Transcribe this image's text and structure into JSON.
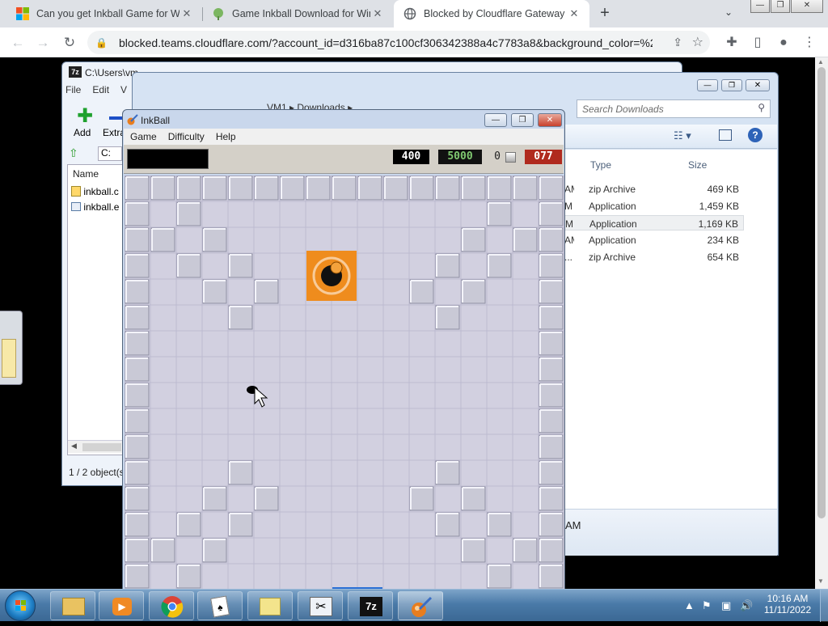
{
  "browser": {
    "tabs": [
      {
        "title": "Can you get Inkball Game for Wi",
        "favicon": "microsoft-icon",
        "active": false
      },
      {
        "title": "Game Inkball Download for Wind",
        "favicon": "brain-icon",
        "active": false
      },
      {
        "title": "Blocked by Cloudflare Gateway",
        "favicon": "globe-icon",
        "active": true
      }
    ],
    "new_tab": "+",
    "tab_search": "⌄",
    "url": "blocked.teams.cloudflare.com/?account_id=d316ba87c100cf306342388a4c7783a8&background_color=%2...",
    "window_controls": {
      "minimize": "—",
      "restore": "❐",
      "close": "✕"
    }
  },
  "zip_window": {
    "title": "C:\\Users\\vm",
    "menu": [
      "File",
      "Edit",
      "V"
    ],
    "toolbar": {
      "add": "Add",
      "extract": "Extra"
    },
    "path": "C:",
    "list_header": "Name",
    "items": [
      "inkball.c",
      "inkball.e"
    ],
    "status": "1 / 2 object(s"
  },
  "explorer_window": {
    "breadcrumb": [
      "VM1",
      "Downloads"
    ],
    "search_placeholder": "Search Downloads",
    "columns": {
      "type": "Type",
      "size": "Size"
    },
    "rows": [
      {
        "prefix": "AM",
        "type": "zip Archive",
        "size": "469 KB",
        "selected": false
      },
      {
        "prefix": "M",
        "type": "Application",
        "size": "1,459 KB",
        "selected": false
      },
      {
        "prefix": "M",
        "type": "Application",
        "size": "1,169 KB",
        "selected": true
      },
      {
        "prefix": "AM",
        "type": "Application",
        "size": "234 KB",
        "selected": false
      },
      {
        "prefix": "...",
        "type": "zip Archive",
        "size": "654 KB",
        "selected": false
      }
    ],
    "details_text": "AM"
  },
  "inkball": {
    "title": "InkBall",
    "menu": [
      "Game",
      "Difficulty",
      "Help"
    ],
    "scores": {
      "blue": "400",
      "target": "5000",
      "zero": "0",
      "timer": "077"
    },
    "colors": {
      "orange_hole": "#ef8c1d",
      "blue_hole": "#2a6fd4",
      "tile": "#c9c9d6",
      "floor": "#d2d0e0"
    }
  },
  "taskbar": {
    "time": "10:16 AM",
    "date": "11/11/2022",
    "apps": [
      "explorer-icon",
      "media-player-icon",
      "chrome-icon",
      "solitaire-icon",
      "sticky-notes-icon",
      "snipping-tool-icon",
      "7zip-icon",
      "inkball-icon"
    ],
    "active_app": "inkball-icon"
  }
}
